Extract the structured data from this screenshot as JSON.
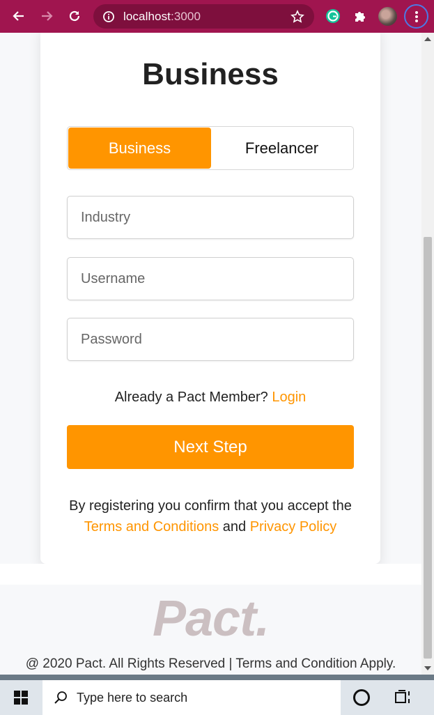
{
  "browser": {
    "url_host": "localhost",
    "url_port": ":3000"
  },
  "card": {
    "title": "Business",
    "toggle": {
      "active_label": "Business",
      "inactive_label": "Freelancer"
    },
    "fields": {
      "industry_placeholder": "Industry",
      "username_placeholder": "Username",
      "password_placeholder": "Password"
    },
    "already_text": "Already a Pact Member?",
    "login_link": "Login",
    "next_button": "Next Step",
    "terms_prefix": "By registering you confirm that you accept the",
    "terms_link": "Terms and Conditions",
    "terms_and": "and",
    "privacy_link": "Privacy Policy"
  },
  "footer": {
    "logo": "Pact.",
    "copyright": "@ 2020 Pact. All Rights Reserved | Terms and Condition Apply."
  },
  "taskbar": {
    "search_placeholder": "Type here to search"
  },
  "colors": {
    "accent": "#ff9500",
    "browser_bar": "#a0154f"
  }
}
